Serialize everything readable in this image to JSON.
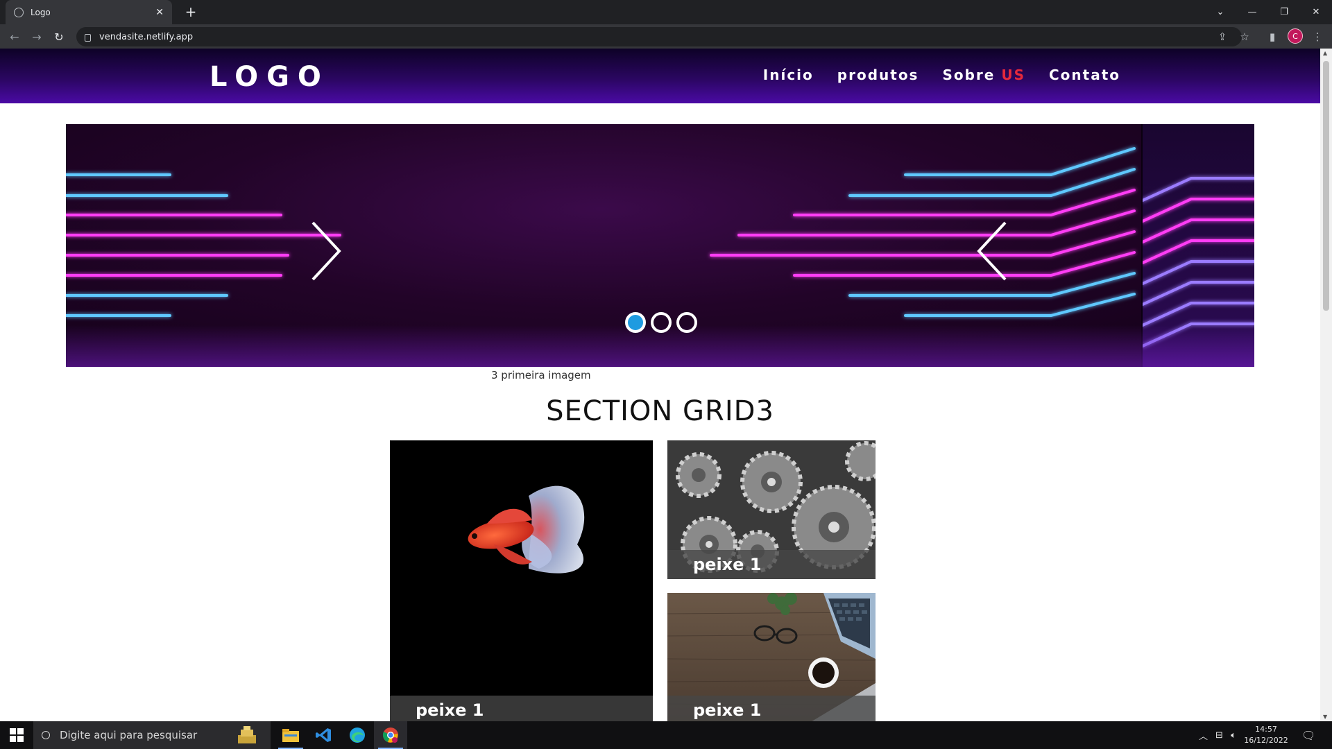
{
  "browser": {
    "tab_title": "Logo",
    "new_tab": "+",
    "url": "vendasite.netlify.app",
    "profile_initial": "C"
  },
  "site": {
    "logo": "LOGO",
    "nav": {
      "inicio": "Início",
      "produtos": "produtos",
      "sobre": "Sobre",
      "us": "US",
      "contato": "Contato"
    },
    "slider": {
      "caption": "3 primeira imagem",
      "slide_count": 3,
      "active_slide": 1
    },
    "section_title": "SECTION GRID3",
    "cards": [
      {
        "label": "peixe 1"
      },
      {
        "label": "peixe 1"
      },
      {
        "label": "peixe 1"
      }
    ]
  },
  "taskbar": {
    "search_placeholder": "Digite aqui para pesquisar",
    "time": "14:57",
    "date": "16/12/2022"
  },
  "colors": {
    "header_top": "#0d0226",
    "header_bottom": "#4a0aa5",
    "nav_accent": "#e5293c",
    "dot_active": "#1e9be0",
    "neon_pink": "#ff3df5",
    "neon_blue": "#5fc8ff",
    "neon_violet": "#9b7bff"
  }
}
